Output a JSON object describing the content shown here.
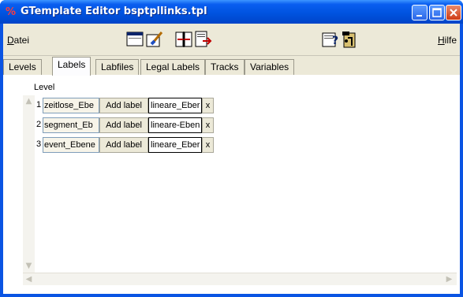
{
  "window": {
    "title": "GTemplate Editor bsptpllinks.tpl",
    "app_icon": "red-logo-icon"
  },
  "menubar": {
    "left_label_hotkey": "D",
    "left_label_rest": "atei",
    "right_label_hotkey": "H",
    "right_label_rest": "ilfe",
    "toolbar_icons": [
      "window-icon",
      "brush-icon",
      "split-icon",
      "export-icon",
      "help-icon",
      "exit-icon"
    ]
  },
  "tabs": [
    {
      "label": "Levels"
    },
    {
      "label": "Labels",
      "active": true
    },
    {
      "label": "Labfiles"
    },
    {
      "label": "Legal Labels"
    },
    {
      "label": "Tracks"
    },
    {
      "label": "Variables"
    }
  ],
  "panel": {
    "column_header": "Level",
    "rows": [
      {
        "num": "1",
        "level_name": "zeitlose_Ebe",
        "add_label": "Add label",
        "label_value": "lineare_Eber",
        "remove": "x"
      },
      {
        "num": "2",
        "level_name": "segment_Eb",
        "add_label": "Add label",
        "label_value": "lineare-Eben",
        "remove": "x"
      },
      {
        "num": "3",
        "level_name": "event_Ebene",
        "add_label": "Add label",
        "label_value": "lineare_Eber",
        "remove": "x"
      }
    ]
  }
}
